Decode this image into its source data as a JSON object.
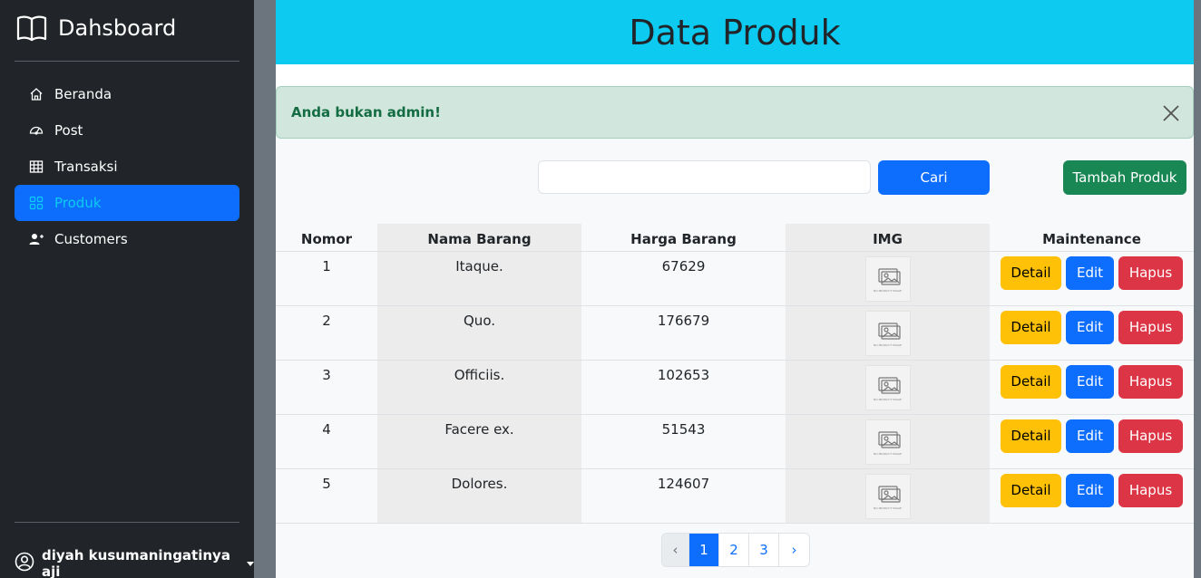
{
  "sidebar": {
    "brand": "Dahsboard",
    "items": [
      {
        "label": "Beranda",
        "icon": "home-icon"
      },
      {
        "label": "Post",
        "icon": "speedometer-icon"
      },
      {
        "label": "Transaksi",
        "icon": "table-icon"
      },
      {
        "label": "Produk",
        "icon": "grid-icon",
        "active": true
      },
      {
        "label": "Customers",
        "icon": "people-icon"
      }
    ],
    "user": "diyah kusumaningatinya aji"
  },
  "main": {
    "title": "Data Produk",
    "alert": "Anda bukan admin!",
    "search": {
      "value": "",
      "placeholder": ""
    },
    "search_button": "Cari",
    "add_button": "Tambah Produk",
    "table": {
      "headers": [
        "Nomor",
        "Nama Barang",
        "Harga Barang",
        "IMG",
        "Maintenance"
      ],
      "rows": [
        {
          "no": "1",
          "name": "Itaque.",
          "price": "67629"
        },
        {
          "no": "2",
          "name": "Quo.",
          "price": "176679"
        },
        {
          "no": "3",
          "name": "Officiis.",
          "price": "102653"
        },
        {
          "no": "4",
          "name": "Facere ex.",
          "price": "51543"
        },
        {
          "no": "5",
          "name": "Dolores.",
          "price": "124607"
        }
      ],
      "image_placeholder": "NO PRODUCT IMAGE",
      "actions": {
        "detail": "Detail",
        "edit": "Edit",
        "delete": "Hapus"
      }
    },
    "pagination": {
      "prev": "‹",
      "pages": [
        "1",
        "2",
        "3"
      ],
      "next": "›",
      "current": "1"
    }
  },
  "colors": {
    "sidebar_bg": "#212529",
    "active_nav": "#0d6efd",
    "header_bg": "#0dcaf0",
    "alert_bg": "#d1e7dd",
    "primary": "#0d6efd",
    "success": "#198754",
    "warning": "#ffc107",
    "danger": "#dc3545"
  }
}
